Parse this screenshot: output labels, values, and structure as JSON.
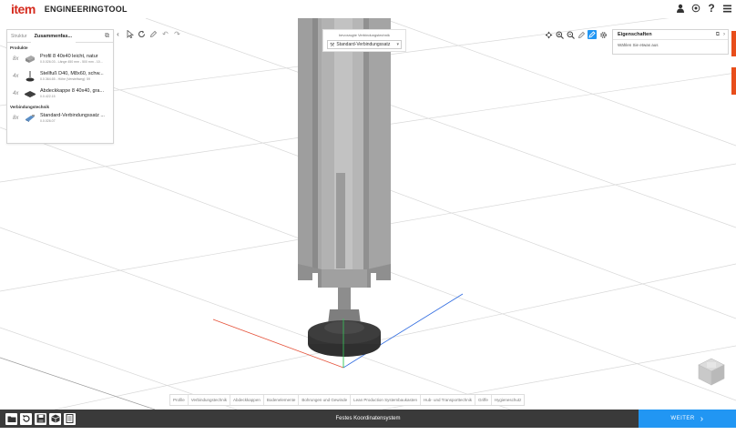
{
  "header": {
    "logo": "item",
    "title": "ENGINEERINGTOOL",
    "icons": [
      "user-icon",
      "share-icon",
      "help-icon",
      "menu-icon"
    ],
    "help_glyph": "?"
  },
  "left_panel": {
    "tabs": [
      {
        "label": "Struktur",
        "active": false
      },
      {
        "label": "Zusammenfas...",
        "active": true
      }
    ],
    "sections": [
      {
        "title": "Produkte",
        "items": [
          {
            "count": "8x",
            "name": "Profil 8 40x40 leicht, natur",
            "sub": "0.0.026.03 - Länge 450 mm - 500 mm - 10...",
            "thumb": "profile-icon"
          },
          {
            "count": "4x",
            "name": "Stellfuß D40, M8x60, schw...",
            "sub": "0.0.364.65 - Höhe (Verstellweg): 59",
            "thumb": "foot-icon"
          },
          {
            "count": "4x",
            "name": "Abdeckkappe 8 40x40, gra...",
            "sub": "0.0.422.15",
            "thumb": "cap-icon"
          }
        ]
      },
      {
        "title": "Verbindungstechnik",
        "items": [
          {
            "count": "8x",
            "name": "Standard-Verbindungssatz ...",
            "sub": "0.0.026.07",
            "thumb": "connector-icon"
          }
        ]
      }
    ]
  },
  "left_toolbar": [
    "collapse-left-icon",
    "select-arrow-icon",
    "rotate-icon",
    "edit-icon",
    "undo-icon",
    "redo-icon"
  ],
  "center": {
    "label": "bevorzugte Verbindungstechnik",
    "selected": "Standard-Verbindungssatz"
  },
  "right_toolbar": [
    {
      "icon": "center-view-icon",
      "active": false
    },
    {
      "icon": "zoom-in-icon",
      "active": false
    },
    {
      "icon": "zoom-out-icon",
      "active": false
    },
    {
      "icon": "measure-icon",
      "active": false
    },
    {
      "icon": "pen-icon",
      "active": true
    },
    {
      "icon": "settings-icon",
      "active": false
    }
  ],
  "properties": {
    "title": "Eigenschaften",
    "body": "Wählen Sie etwas aus"
  },
  "categories": [
    "Profile",
    "Verbindungstechnik",
    "Abdeckkappen",
    "Bodenelemente",
    "Bohrungen und Gewinde",
    "Lean Production Systembaukasten",
    "Hub- und Transporttechnik",
    "Griffe",
    "Hygieneschutz"
  ],
  "footer": {
    "buttons": [
      "folder-icon",
      "reset-icon",
      "save-icon",
      "cube-export-icon",
      "document-icon"
    ],
    "status": "Festes Koordinatensystem",
    "next_label": "WEITER"
  },
  "colors": {
    "brand_red": "#d52b1e",
    "accent_blue": "#2196f3",
    "footer_dark": "#3a3a3a",
    "side_tab_orange": "#e84e1b"
  }
}
